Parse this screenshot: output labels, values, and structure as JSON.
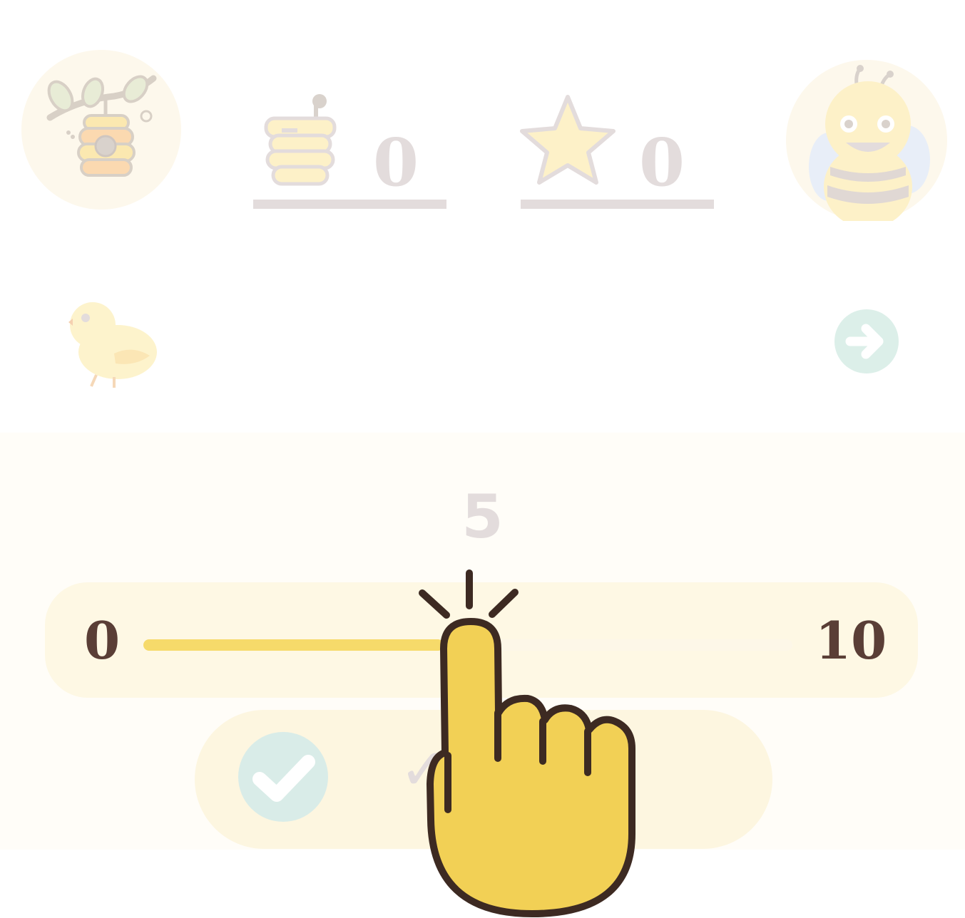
{
  "header": {
    "honey_count": "0",
    "star_count": "0",
    "icons": {
      "hive": "beehive-icon",
      "honey_pot": "honey-pot-icon",
      "star": "star-icon",
      "bee": "bee-avatar-icon"
    }
  },
  "prompt_row": {
    "left_icon": "chick-icon",
    "next_icon": "arrow-right-icon"
  },
  "slider": {
    "current_value": "5",
    "min_label": "0",
    "max_label": "10",
    "value": 5,
    "min": 0,
    "max": 10
  },
  "confirm": {
    "icon": "checkmark-icon",
    "label": "✓"
  },
  "overlay": {
    "icon": "pointing-hand-icon"
  },
  "colors": {
    "faded_gray": "#e3dcdc",
    "slider_fill": "#f6da6a",
    "label_brown": "#5a3e36",
    "hand_yellow": "#f2d055",
    "hand_outline": "#3d2a22",
    "teal_faded": "#d9ece8"
  }
}
